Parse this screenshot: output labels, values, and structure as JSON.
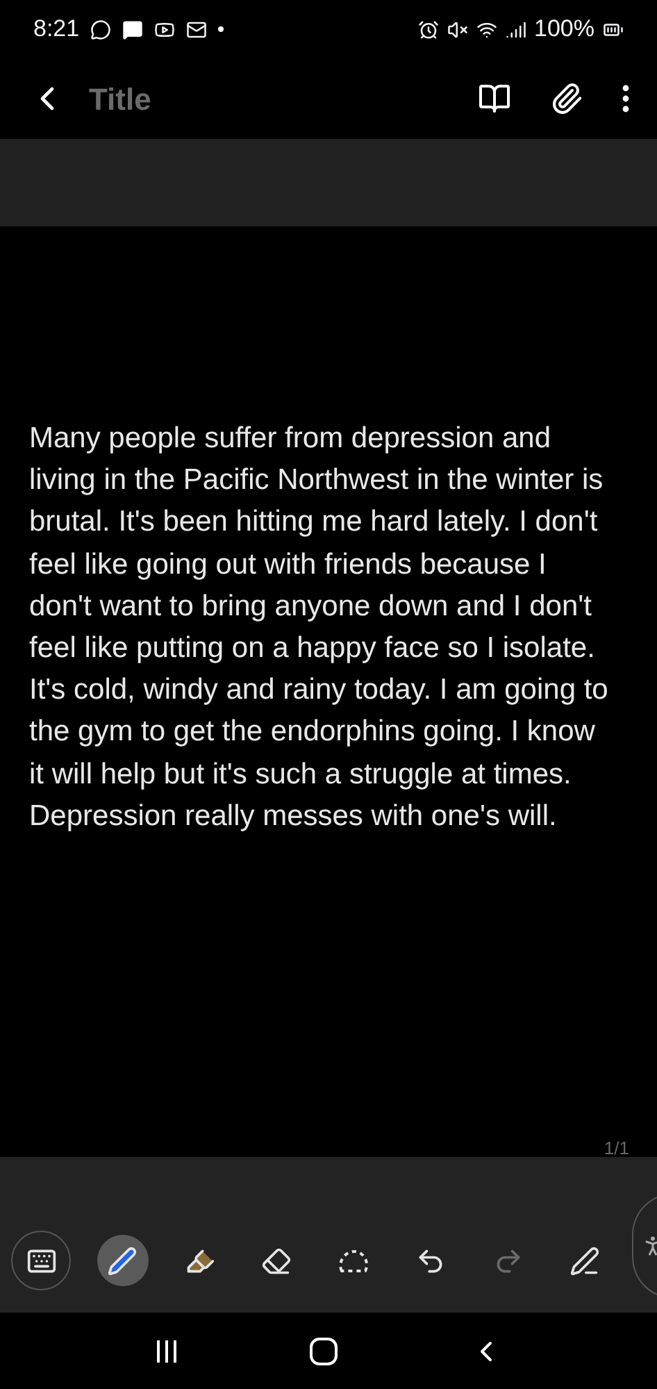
{
  "status_bar": {
    "time": "8:21",
    "battery": "100%"
  },
  "header": {
    "title_placeholder": "Title"
  },
  "note": {
    "body": "Many people suffer from depression and living in the Pacific Northwest in the winter is brutal. It's been hitting me hard lately. I don't feel like going out with friends because I don't want to bring anyone down and I don't feel like putting on a happy face so I isolate. It's cold, windy and rainy today. I am going to the gym to get the endorphins going. I know it will help but it's such a struggle at times. Depression really messes with one's will.",
    "page_count": "1/1"
  },
  "tools": [
    {
      "kind": "keyboard",
      "selected": false,
      "disabled": false
    },
    {
      "kind": "pen",
      "selected": true,
      "disabled": false
    },
    {
      "kind": "highlighter",
      "selected": false,
      "disabled": false
    },
    {
      "kind": "eraser",
      "selected": false,
      "disabled": false
    },
    {
      "kind": "lasso",
      "selected": false,
      "disabled": false
    },
    {
      "kind": "undo",
      "selected": false,
      "disabled": false
    },
    {
      "kind": "redo",
      "selected": false,
      "disabled": true
    },
    {
      "kind": "pen-text",
      "selected": false,
      "disabled": false
    }
  ]
}
